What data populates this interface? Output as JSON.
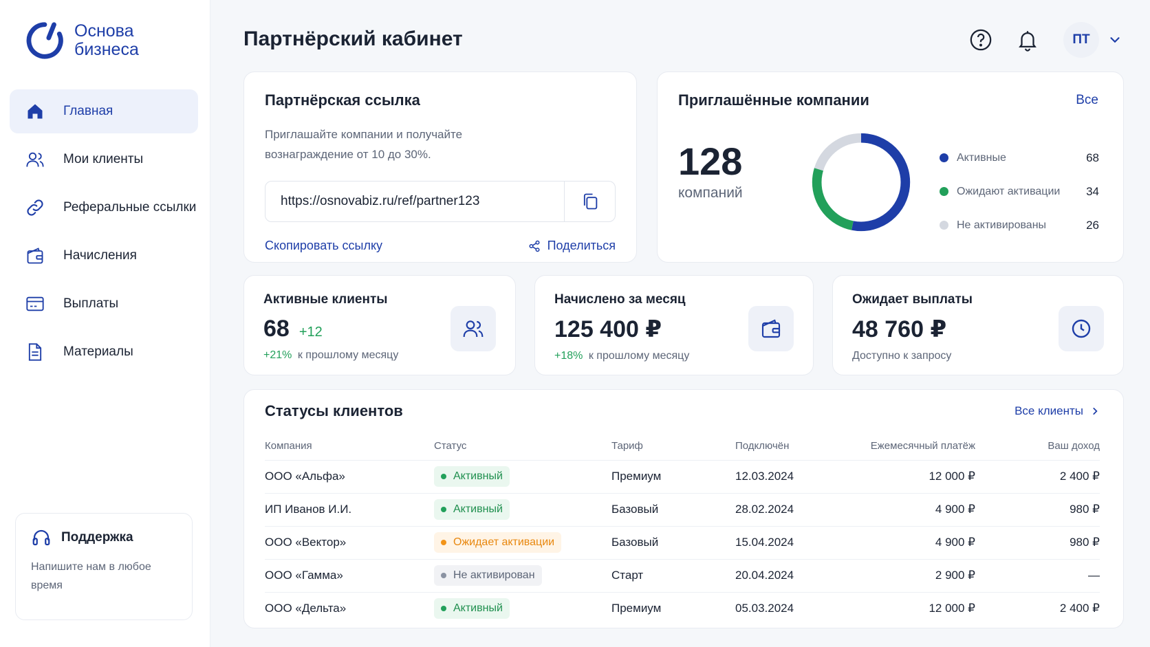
{
  "brand": {
    "line1": "Основа",
    "line2": "бизнеса"
  },
  "colors": {
    "accent": "#1e3ea8",
    "active": "#22a05a",
    "pending": "#f29318",
    "inactive": "#d4d8e0"
  },
  "sidebar": {
    "items": [
      {
        "label": "Главная",
        "icon": "home-icon"
      },
      {
        "label": "Мои клиенты",
        "icon": "users-icon"
      },
      {
        "label": "Реферальные ссылки",
        "icon": "link-icon"
      },
      {
        "label": "Начисления",
        "icon": "wallet-icon"
      },
      {
        "label": "Выплаты",
        "icon": "card-icon"
      },
      {
        "label": "Материалы",
        "icon": "document-icon"
      }
    ],
    "support": {
      "title": "Поддержка",
      "text": "Напишите нам в любое время"
    }
  },
  "header": {
    "title": "Партнёрский кабинет",
    "avatar_initials": "ПТ"
  },
  "referral": {
    "title": "Партнёрская ссылка",
    "description": "Приглашайте компании и получайте вознаграждение от 10 до 30%.",
    "url": "https://osnovabiz.ru/ref/partner123",
    "copy_label": "Скопировать ссылку",
    "share_label": "Поделиться"
  },
  "invited": {
    "title": "Приглашённые компании",
    "all_label": "Все",
    "total": "128",
    "unit": "компаний",
    "segments": [
      {
        "label": "Активные",
        "value": 68,
        "display": "68",
        "color": "#1e3ea8"
      },
      {
        "label": "Ожидают активации",
        "value": 34,
        "display": "34",
        "color": "#22a05a"
      },
      {
        "label": "Не активированы",
        "value": 26,
        "display": "26",
        "color": "#d4d8e0"
      }
    ]
  },
  "stats": [
    {
      "label": "Активные клиенты",
      "value": "68",
      "delta": "+12",
      "sub_green": "+21%",
      "sub": "к прошлому месяцу"
    },
    {
      "label": "Начислено за месяц",
      "value": "125 400 ₽",
      "sub_green": "+18%",
      "sub": "к прошлому месяцу"
    },
    {
      "label": "Ожидает выплаты",
      "value": "48 760 ₽",
      "sub": "Доступно к запросу"
    }
  ],
  "clients": {
    "title": "Статусы клиентов",
    "all_label": "Все клиенты",
    "columns": [
      "Компания",
      "Статус",
      "Тариф",
      "Подключён",
      "Ежемесячный платёж",
      "Ваш доход"
    ],
    "rows": [
      {
        "company": "ООО «Альфа»",
        "status": "Активный",
        "status_type": "active",
        "tariff": "Премиум",
        "date": "12.03.2024",
        "payment": "12 000 ₽",
        "income": "2 400 ₽"
      },
      {
        "company": "ИП Иванов И.И.",
        "status": "Активный",
        "status_type": "active",
        "tariff": "Базовый",
        "date": "28.02.2024",
        "payment": "4 900 ₽",
        "income": "980 ₽"
      },
      {
        "company": "ООО «Вектор»",
        "status": "Ожидает активации",
        "status_type": "pending",
        "tariff": "Базовый",
        "date": "15.04.2024",
        "payment": "4 900 ₽",
        "income": "980 ₽"
      },
      {
        "company": "ООО «Гамма»",
        "status": "Не активирован",
        "status_type": "inactive",
        "tariff": "Старт",
        "date": "20.04.2024",
        "payment": "2 900 ₽",
        "income": "—"
      },
      {
        "company": "ООО «Дельта»",
        "status": "Активный",
        "status_type": "active",
        "tariff": "Премиум",
        "date": "05.03.2024",
        "payment": "12 000 ₽",
        "income": "2 400 ₽"
      }
    ]
  }
}
